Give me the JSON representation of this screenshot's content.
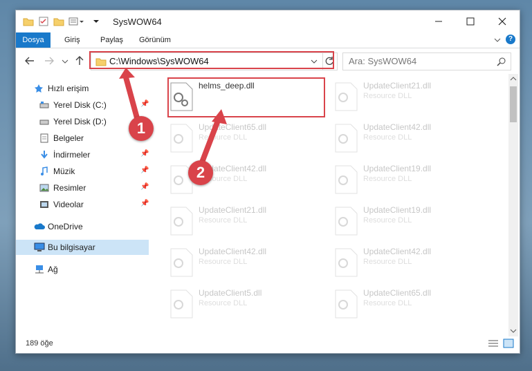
{
  "window": {
    "title": "SysWOW64"
  },
  "ribbon": {
    "tabs": [
      "Dosya",
      "Giriş",
      "Paylaş",
      "Görünüm"
    ]
  },
  "address": {
    "path": "C:\\Windows\\SysWOW64"
  },
  "search": {
    "placeholder": "Ara: SysWOW64"
  },
  "sidebar": {
    "items": [
      {
        "label": "Hızlı erişim"
      },
      {
        "label": "Yerel Disk (C:)"
      },
      {
        "label": "Yerel Disk (D:)"
      },
      {
        "label": "Belgeler"
      },
      {
        "label": "İndirmeler"
      },
      {
        "label": "Müzik"
      },
      {
        "label": "Resimler"
      },
      {
        "label": "Videolar"
      },
      {
        "label": "OneDrive"
      },
      {
        "label": "Bu bilgisayar"
      },
      {
        "label": "Ağ"
      }
    ]
  },
  "files": [
    {
      "name": "helms_deep.dll",
      "type": ""
    },
    {
      "name": "UpdateClient21.dll",
      "type": "Resource DLL"
    },
    {
      "name": "UpdateClient65.dll",
      "type": "Resource DLL"
    },
    {
      "name": "UpdateClient42.dll",
      "type": "Resource DLL"
    },
    {
      "name": "UpdateClient42.dll",
      "type": "Resource DLL"
    },
    {
      "name": "UpdateClient19.dll",
      "type": "Resource DLL"
    },
    {
      "name": "UpdateClient21.dll",
      "type": "Resource DLL"
    },
    {
      "name": "UpdateClient19.dll",
      "type": "Resource DLL"
    },
    {
      "name": "UpdateClient42.dll",
      "type": "Resource DLL"
    },
    {
      "name": "UpdateClient42.dll",
      "type": "Resource DLL"
    },
    {
      "name": "UpdateClient5.dll",
      "type": "Resource DLL"
    },
    {
      "name": "UpdateClient65.dll",
      "type": "Resource DLL"
    }
  ],
  "status": {
    "count": "189 öğe"
  },
  "annotations": {
    "one": "1",
    "two": "2"
  },
  "colors": {
    "accent": "#1979ca",
    "highlight": "#d9434a",
    "selected": "#cce4f7"
  }
}
